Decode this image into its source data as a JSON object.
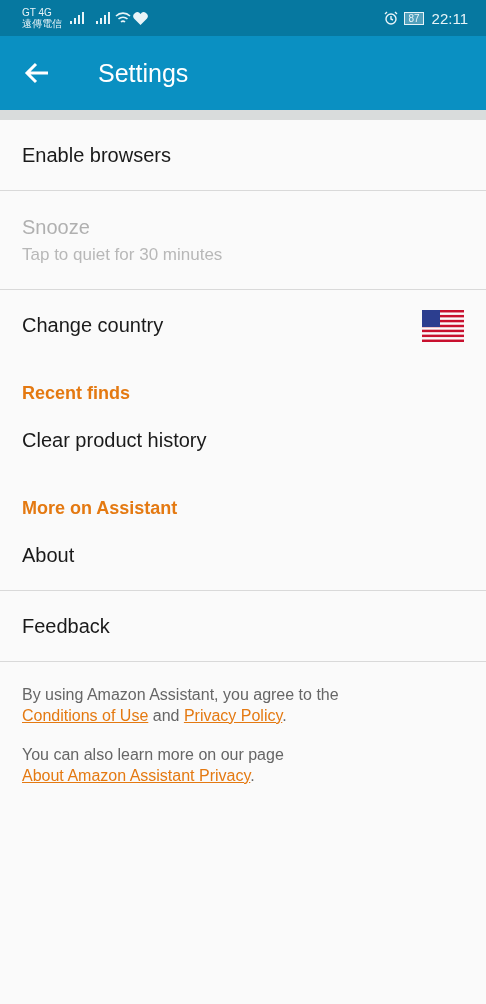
{
  "status_bar": {
    "carrier_network": "GT 4G",
    "carrier_name": "遠傳電信",
    "battery": "87",
    "time": "22:11"
  },
  "app_bar": {
    "title": "Settings"
  },
  "items": [
    {
      "kind": "item",
      "label": "Enable browsers",
      "disabled": false,
      "divider": true
    },
    {
      "kind": "item",
      "label": "Snooze",
      "subtitle": "Tap to quiet for 30 minutes",
      "disabled": true,
      "divider": true
    },
    {
      "kind": "flag",
      "label": "Change country",
      "disabled": false,
      "divider": false
    },
    {
      "kind": "header",
      "label": "Recent finds"
    },
    {
      "kind": "item",
      "label": "Clear product history",
      "disabled": false,
      "divider": false
    },
    {
      "kind": "header",
      "label": "More on Assistant"
    },
    {
      "kind": "item",
      "label": "About",
      "disabled": false,
      "divider": true
    },
    {
      "kind": "item",
      "label": "Feedback",
      "disabled": false,
      "divider": true
    }
  ],
  "footer": [
    [
      {
        "text": "By using Amazon Assistant, you agree to the ",
        "link": false
      },
      {
        "text": "Conditions of Use",
        "link": true
      },
      {
        "text": " and ",
        "link": false
      },
      {
        "text": "Privacy Policy",
        "link": true
      },
      {
        "text": ".",
        "link": false
      }
    ],
    [
      {
        "text": "You can also learn more on our page ",
        "link": false
      },
      {
        "text": "About Amazon Assistant Privacy",
        "link": true
      },
      {
        "text": ".",
        "link": false
      }
    ]
  ]
}
